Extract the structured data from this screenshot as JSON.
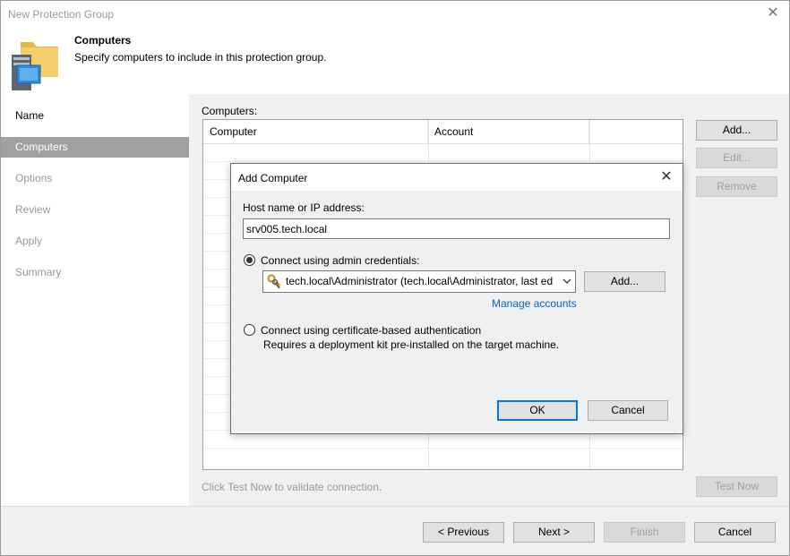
{
  "window": {
    "title": "New Protection Group"
  },
  "header": {
    "title": "Computers",
    "subtitle": "Specify computers to include in this protection group."
  },
  "sidebar": {
    "items": [
      {
        "label": "Name"
      },
      {
        "label": "Computers"
      },
      {
        "label": "Options"
      },
      {
        "label": "Review"
      },
      {
        "label": "Apply"
      },
      {
        "label": "Summary"
      }
    ]
  },
  "content": {
    "computers_label": "Computers:",
    "columns": [
      "Computer",
      "Account"
    ],
    "buttons": {
      "add": "Add...",
      "edit": "Edit...",
      "remove": "Remove",
      "test_now": "Test Now"
    },
    "hint": "Click Test Now to validate connection."
  },
  "footer": {
    "previous": "< Previous",
    "next": "Next >",
    "finish": "Finish",
    "cancel": "Cancel"
  },
  "dialog": {
    "title": "Add Computer",
    "host_label": "Host name or IP address:",
    "host_value": "srv005.tech.local",
    "admin_option": "Connect using admin credentials:",
    "credentials_value": "tech.local\\Administrator (tech.local\\Administrator, last ed",
    "add_button": "Add...",
    "manage_accounts": "Manage accounts",
    "cert_option": "Connect using certificate-based authentication",
    "cert_description": "Requires a deployment kit pre-installed on the target machine.",
    "ok": "OK",
    "cancel": "Cancel"
  },
  "colors": {
    "accent": "#0078d7",
    "link": "#0066cc",
    "active_step": "#a0a0a0"
  },
  "icons": [
    "close-icon",
    "protection-group-icon",
    "key-icon",
    "chevron-down-icon"
  ]
}
